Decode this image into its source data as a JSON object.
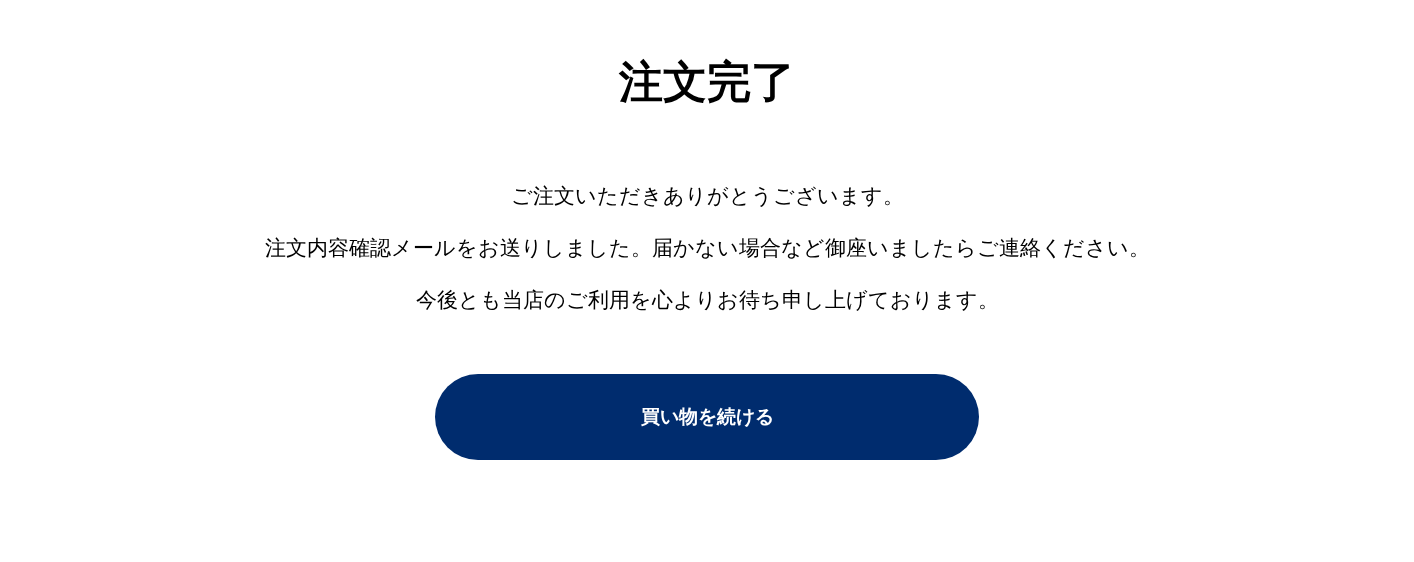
{
  "heading": "注文完了",
  "message_lines": [
    "ご注文いただきありがとうございます。",
    "注文内容確認メールをお送りしました。届かない場合など御座いましたらご連絡ください。",
    "今後とも当店のご利用を心よりお待ち申し上げております。"
  ],
  "button": {
    "label": "買い物を続ける"
  }
}
